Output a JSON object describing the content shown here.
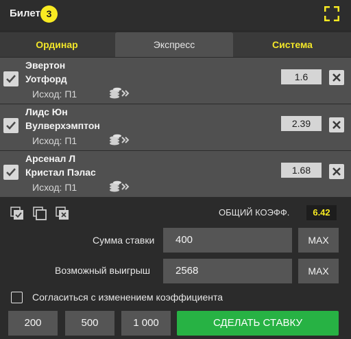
{
  "ticket": {
    "title": "Билет",
    "count": "3"
  },
  "tabs": [
    {
      "label": "Ординар",
      "active": false
    },
    {
      "label": "Экспресс",
      "active": true
    },
    {
      "label": "Система",
      "active": false
    }
  ],
  "bets": [
    {
      "home": "Эвертон",
      "away": "Уотфорд",
      "outcome": "Исход: П1",
      "odds": "1.6",
      "checked": true
    },
    {
      "home": "Лидс Юн",
      "away": "Вулверхэмптон",
      "outcome": "Исход: П1",
      "odds": "2.39",
      "checked": true
    },
    {
      "home": "Арсенал Л",
      "away": "Кристал Пэлас",
      "outcome": "Исход: П1",
      "odds": "1.68",
      "checked": true
    }
  ],
  "summary": {
    "total_odds_label": "ОБЩИЙ КОЭФФ.",
    "total_odds_value": "6.42"
  },
  "stake": {
    "label": "Сумма ставки",
    "value": "400",
    "max_label": "MAX"
  },
  "win": {
    "label": "Возможный выигрыш",
    "value": "2568",
    "max_label": "MAX"
  },
  "agree": {
    "label": "Согласиться с изменением коэффициента",
    "checked": false
  },
  "presets": [
    "200",
    "500",
    "1 000"
  ],
  "place_bet_label": "СДЕЛАТЬ СТАВКУ",
  "colors": {
    "accent_yellow": "#f8ea22",
    "tab_yellow": "#f2e629",
    "green": "#27b244",
    "panel": "#505050",
    "background": "#2b2b2b"
  },
  "icons": [
    "expand-icon",
    "checkmark-icon",
    "close-icon",
    "coins-icon",
    "select-all-icon",
    "copy-icon",
    "delete-all-icon"
  ]
}
